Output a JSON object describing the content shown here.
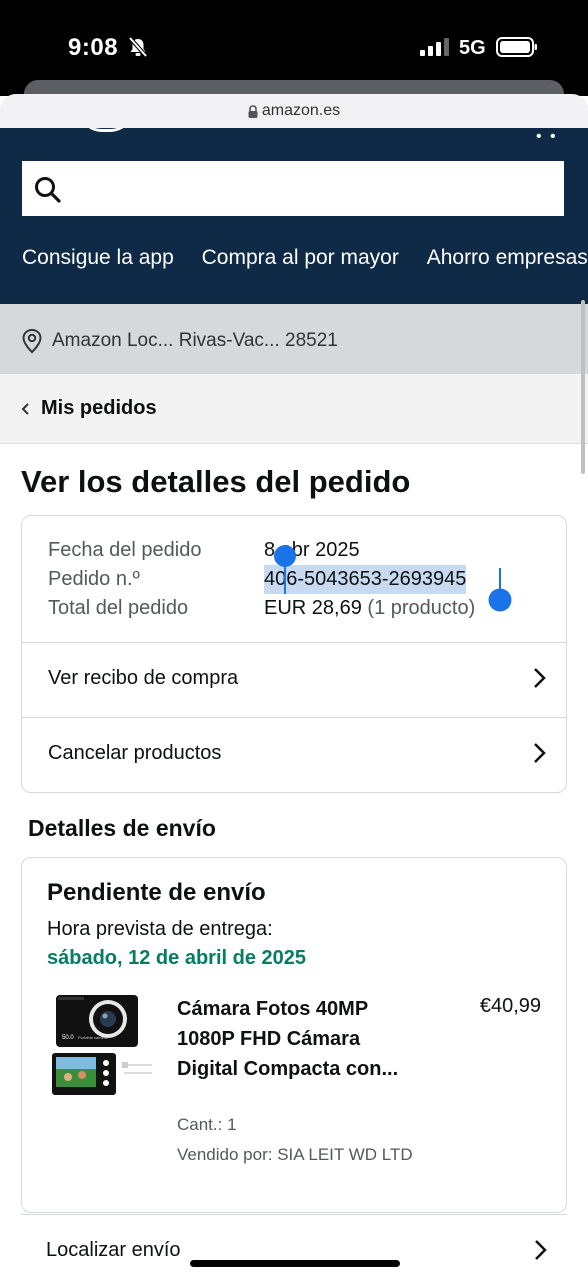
{
  "status_bar": {
    "time": "9:08",
    "network": "5G"
  },
  "browser": {
    "url": "amazon.es"
  },
  "header": {
    "search": {
      "placeholder": ""
    },
    "nav": [
      "Consigue la app",
      "Compra al por mayor",
      "Ahorro empresas"
    ]
  },
  "location": {
    "text": "Amazon Loc... Rivas-Vac... 28521"
  },
  "back_nav": {
    "label": "Mis pedidos"
  },
  "page": {
    "title": "Ver los detalles del pedido"
  },
  "order": {
    "date_label": "Fecha del pedido",
    "date_value": "8 abr 2025",
    "number_label": "Pedido n.º",
    "number_value": "406-5043653-2693945",
    "total_label": "Total del pedido",
    "total_value": "EUR 28,69",
    "total_count": "(1 producto)",
    "receipt_label": "Ver recibo de compra",
    "cancel_label": "Cancelar productos"
  },
  "shipping": {
    "heading": "Detalles de envío",
    "status": "Pendiente de envío",
    "eta_label": "Hora prevista de entrega:",
    "eta_date": "sábado, 12 de abril de 2025",
    "product": {
      "title": "Cámara Fotos 40MP 1080P FHD Cámara Digital Compacta con...",
      "price": "€40,99",
      "quantity": "Cant.: 1",
      "seller": "Vendido por: SIA LEIT WD LTD",
      "image_caption": "Portable camera",
      "image_badge": "50.0"
    },
    "track_label": "Localizar envío"
  },
  "colors": {
    "header_bg": "#0e2a47",
    "eta_green": "#067d62",
    "selection": "#c7daf2",
    "caret": "#1a73e8"
  }
}
